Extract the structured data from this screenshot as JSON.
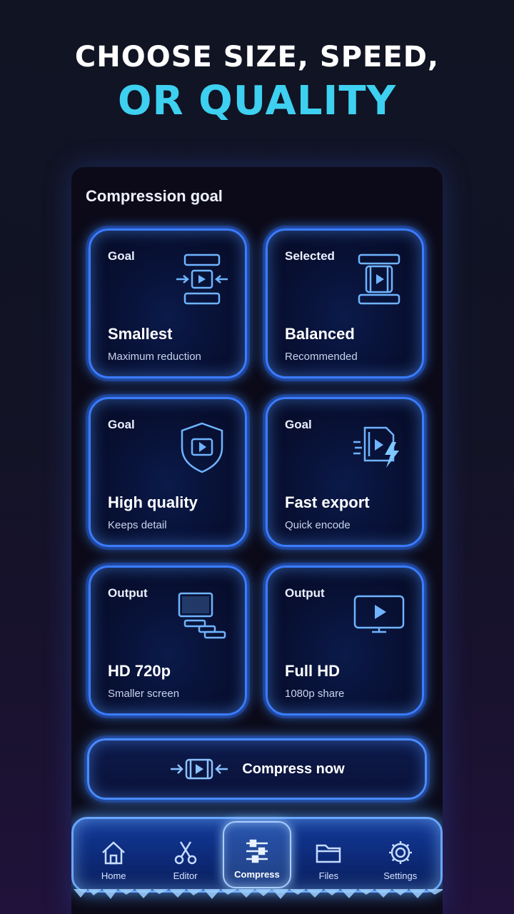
{
  "headline": {
    "line1": "CHOOSE SIZE, SPEED,",
    "line2": "OR QUALITY"
  },
  "section_title": "Compression goal",
  "cards": [
    {
      "tag": "Goal",
      "name": "Smallest",
      "sub": "Maximum reduction",
      "icon": "compress-icon"
    },
    {
      "tag": "Selected",
      "name": "Balanced",
      "sub": "Recommended",
      "icon": "balance-video-icon"
    },
    {
      "tag": "Goal",
      "name": "High quality",
      "sub": "Keeps detail",
      "icon": "shield-play-icon"
    },
    {
      "tag": "Goal",
      "name": "Fast export",
      "sub": "Quick encode",
      "icon": "lightning-video-icon"
    },
    {
      "tag": "Output",
      "name": "HD 720p",
      "sub": "Smaller screen",
      "icon": "monitor-icon"
    },
    {
      "tag": "Output",
      "name": "Full HD",
      "sub": "1080p share",
      "icon": "tv-play-icon"
    }
  ],
  "compress_button": {
    "label": "Compress now",
    "icon": "compress-arrows-icon"
  },
  "nav": [
    {
      "label": "Home",
      "icon": "home-icon",
      "active": false
    },
    {
      "label": "Editor",
      "icon": "scissors-icon",
      "active": false
    },
    {
      "label": "Compress",
      "icon": "sliders-icon",
      "active": true
    },
    {
      "label": "Files",
      "icon": "folder-icon",
      "active": false
    },
    {
      "label": "Settings",
      "icon": "gear-icon",
      "active": false
    }
  ],
  "colors": {
    "accent_cyan": "#3ed0f0",
    "neon_blue": "#3a7cff",
    "background": "#0c0a18"
  }
}
